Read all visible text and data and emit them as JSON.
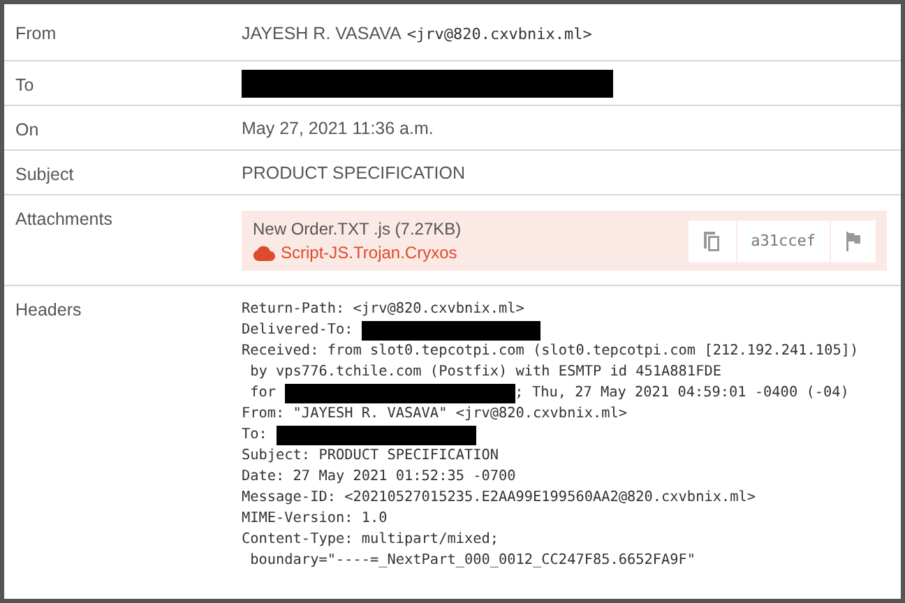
{
  "rows": [
    {
      "label": "From",
      "kind": "sender",
      "name": "JAYESH R. VASAVA",
      "address": "<jrv@820.cxvbnix.ml>"
    },
    {
      "label": "To",
      "kind": "redacted"
    },
    {
      "label": "On",
      "kind": "text",
      "text": "May 27, 2021 11:36 a.m."
    },
    {
      "label": "Subject",
      "kind": "text",
      "text": "PRODUCT SPECIFICATION"
    },
    {
      "label": "Attachments",
      "kind": "attachment",
      "file": "New Order.TXT .js (7.27KB)",
      "detection": "Script-JS.Trojan.Cryxos",
      "hash": "a31ccef"
    },
    {
      "label": "Headers",
      "kind": "headers",
      "lines": [
        [
          {
            "kind": "text",
            "text": "Return-Path: <jrv@820.cxvbnix.ml>"
          }
        ],
        [
          {
            "kind": "text",
            "text": "Delivered-To: "
          },
          {
            "kind": "redacted"
          }
        ],
        [
          {
            "kind": "text",
            "text": "Received: from slot0.tepcotpi.com (slot0.tepcotpi.com [212.192.241.105])"
          }
        ],
        [
          {
            "kind": "text",
            "text": " by vps776.tchile.com (Postfix) with ESMTP id 451A881FDE"
          }
        ],
        [
          {
            "kind": "text",
            "text": " for "
          },
          {
            "kind": "redacted"
          },
          {
            "kind": "text",
            "text": "; Thu, 27 May 2021 04:59:01 -0400 (-04)"
          }
        ],
        [
          {
            "kind": "text",
            "text": "From: \"JAYESH R. VASAVA\" <jrv@820.cxvbnix.ml>"
          }
        ],
        [
          {
            "kind": "text",
            "text": "To: "
          },
          {
            "kind": "redacted"
          }
        ],
        [
          {
            "kind": "text",
            "text": "Subject: PRODUCT SPECIFICATION"
          }
        ],
        [
          {
            "kind": "text",
            "text": "Date: 27 May 2021 01:52:35 -0700"
          }
        ],
        [
          {
            "kind": "text",
            "text": "Message-ID: <20210527015235.E2AA99E199560AA2@820.cxvbnix.ml>"
          }
        ],
        [
          {
            "kind": "text",
            "text": "MIME-Version: 1.0"
          }
        ],
        [
          {
            "kind": "text",
            "text": "Content-Type: multipart/mixed;"
          }
        ],
        [
          {
            "kind": "text",
            "text": " boundary=\"----=_NextPart_000_0012_CC247F85.6652FA9F\""
          }
        ]
      ]
    }
  ]
}
